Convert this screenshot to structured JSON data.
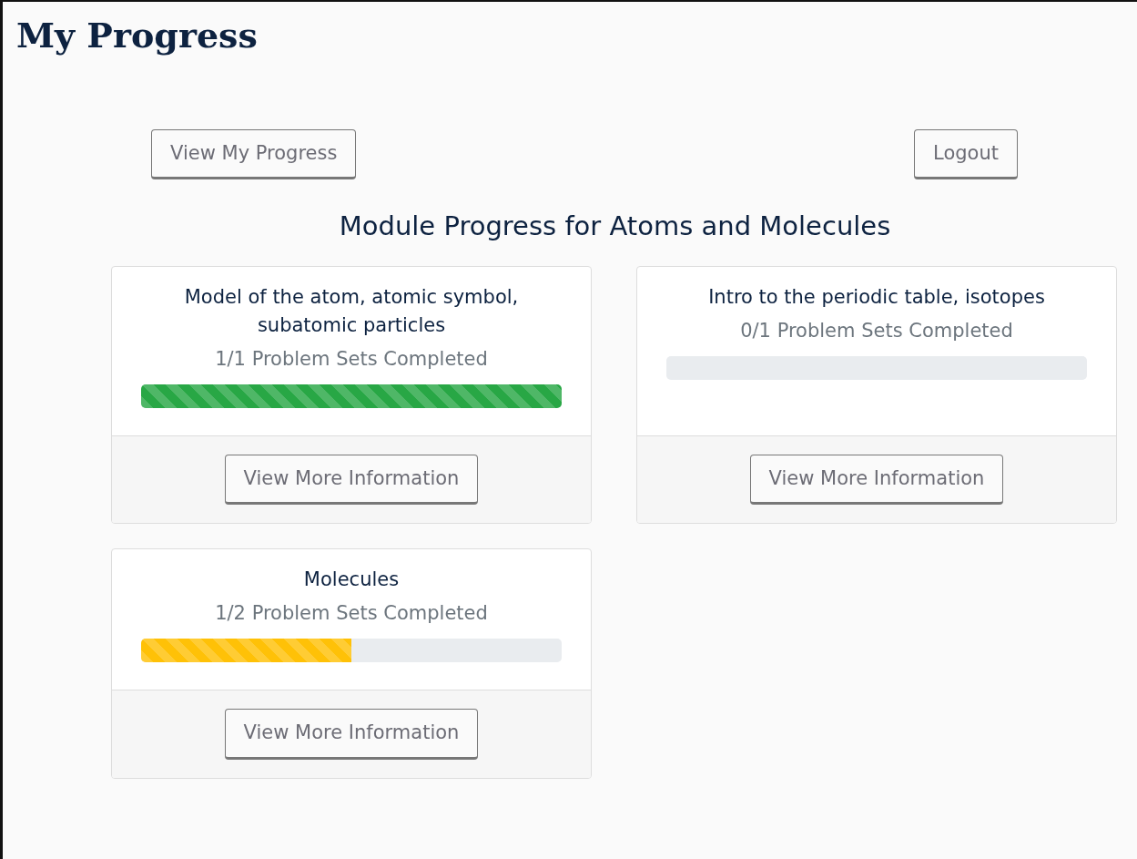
{
  "page_title": "My Progress",
  "actions": [
    {
      "label": "View My Progress"
    },
    {
      "label": "Logout"
    }
  ],
  "heading": "Module Progress for Atoms and Molecules",
  "modules": [
    {
      "title": "Model of the atom, atomic symbol, subatomic particles",
      "status": "1/1 Problem Sets Completed",
      "level": 1,
      "button": "View More Information"
    },
    {
      "title": "Intro to the periodic table, isotopes",
      "status": "0/1 Problem Sets Completed",
      "level": 0,
      "button": "View More Information"
    },
    {
      "title": "Molecules",
      "status": "1/2 Problem Sets Completed",
      "level": 0.5,
      "button": "View More Information"
    }
  ]
}
